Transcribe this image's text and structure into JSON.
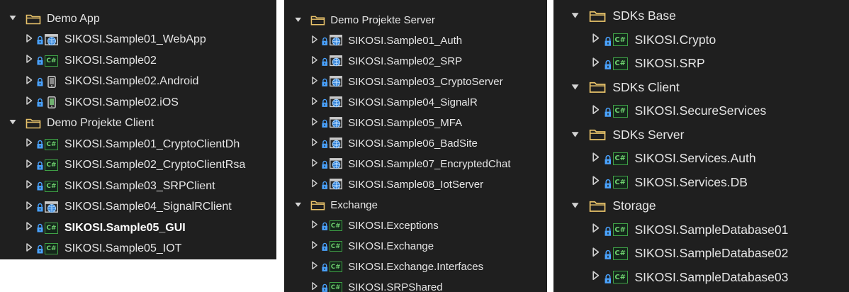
{
  "colors": {
    "background": "#1f1f1f",
    "text": "#e6e6e6",
    "csharp_icon": "#3fa046",
    "lock_icon": "#4aa3ff",
    "globe_icon": "#2e7fd6"
  },
  "panel1": {
    "rows": [
      {
        "label": "Demo App",
        "type": "folder",
        "expanded": true,
        "icon": "folder-icon"
      },
      {
        "label": "SIKOSI.Sample01_WebApp",
        "type": "project",
        "icon": "web-project-icon"
      },
      {
        "label": "SIKOSI.Sample02",
        "type": "project",
        "icon": "csharp-project-icon"
      },
      {
        "label": "SIKOSI.Sample02.Android",
        "type": "project",
        "icon": "android-project-icon"
      },
      {
        "label": "SIKOSI.Sample02.iOS",
        "type": "project",
        "icon": "ios-project-icon"
      },
      {
        "label": "Demo Projekte Client",
        "type": "folder",
        "expanded": true,
        "icon": "folder-icon"
      },
      {
        "label": "SIKOSI.Sample01_CryptoClientDh",
        "type": "project",
        "icon": "csharp-project-icon"
      },
      {
        "label": "SIKOSI.Sample02_CryptoClientRsa",
        "type": "project",
        "icon": "csharp-project-icon"
      },
      {
        "label": "SIKOSI.Sample03_SRPClient",
        "type": "project",
        "icon": "csharp-project-icon"
      },
      {
        "label": "SIKOSI.Sample04_SignalRClient",
        "type": "project",
        "icon": "web-project-icon"
      },
      {
        "label": "SIKOSI.Sample05_GUI",
        "type": "project",
        "icon": "csharp-project-icon",
        "bold": true
      },
      {
        "label": "SIKOSI.Sample05_IOT",
        "type": "project",
        "icon": "csharp-project-icon"
      }
    ]
  },
  "panel2": {
    "rows": [
      {
        "label": "Demo Projekte Server",
        "type": "folder",
        "expanded": true,
        "icon": "folder-icon"
      },
      {
        "label": "SIKOSI.Sample01_Auth",
        "type": "project",
        "icon": "web-project-icon"
      },
      {
        "label": "SIKOSI.Sample02_SRP",
        "type": "project",
        "icon": "web-project-icon"
      },
      {
        "label": "SIKOSI.Sample03_CryptoServer",
        "type": "project",
        "icon": "web-project-icon"
      },
      {
        "label": "SIKOSI.Sample04_SignalR",
        "type": "project",
        "icon": "web-project-icon"
      },
      {
        "label": "SIKOSI.Sample05_MFA",
        "type": "project",
        "icon": "web-project-icon"
      },
      {
        "label": "SIKOSI.Sample06_BadSite",
        "type": "project",
        "icon": "web-project-icon"
      },
      {
        "label": "SIKOSI.Sample07_EncryptedChat",
        "type": "project",
        "icon": "web-project-icon"
      },
      {
        "label": "SIKOSI.Sample08_IotServer",
        "type": "project",
        "icon": "web-project-icon"
      },
      {
        "label": "Exchange",
        "type": "folder",
        "expanded": true,
        "icon": "folder-icon"
      },
      {
        "label": "SIKOSI.Exceptions",
        "type": "project",
        "icon": "csharp-project-icon"
      },
      {
        "label": "SIKOSI.Exchange",
        "type": "project",
        "icon": "csharp-project-icon"
      },
      {
        "label": "SIKOSI.Exchange.Interfaces",
        "type": "project",
        "icon": "csharp-project-icon"
      },
      {
        "label": "SIKOSI.SRPShared",
        "type": "project",
        "icon": "csharp-project-icon"
      }
    ]
  },
  "panel3": {
    "rows": [
      {
        "label": "SDKs Base",
        "type": "folder",
        "expanded": true,
        "icon": "folder-icon"
      },
      {
        "label": "SIKOSI.Crypto",
        "type": "project",
        "icon": "csharp-project-icon"
      },
      {
        "label": "SIKOSI.SRP",
        "type": "project",
        "icon": "csharp-project-icon"
      },
      {
        "label": "SDKs Client",
        "type": "folder",
        "expanded": true,
        "icon": "folder-icon"
      },
      {
        "label": "SIKOSI.SecureServices",
        "type": "project",
        "icon": "csharp-project-icon"
      },
      {
        "label": "SDKs Server",
        "type": "folder",
        "expanded": true,
        "icon": "folder-icon"
      },
      {
        "label": "SIKOSI.Services.Auth",
        "type": "project",
        "icon": "csharp-project-icon"
      },
      {
        "label": "SIKOSI.Services.DB",
        "type": "project",
        "icon": "csharp-project-icon"
      },
      {
        "label": "Storage",
        "type": "folder",
        "expanded": true,
        "icon": "folder-icon"
      },
      {
        "label": "SIKOSI.SampleDatabase01",
        "type": "project",
        "icon": "csharp-project-icon"
      },
      {
        "label": "SIKOSI.SampleDatabase02",
        "type": "project",
        "icon": "csharp-project-icon"
      },
      {
        "label": "SIKOSI.SampleDatabase03",
        "type": "project",
        "icon": "csharp-project-icon"
      }
    ]
  }
}
